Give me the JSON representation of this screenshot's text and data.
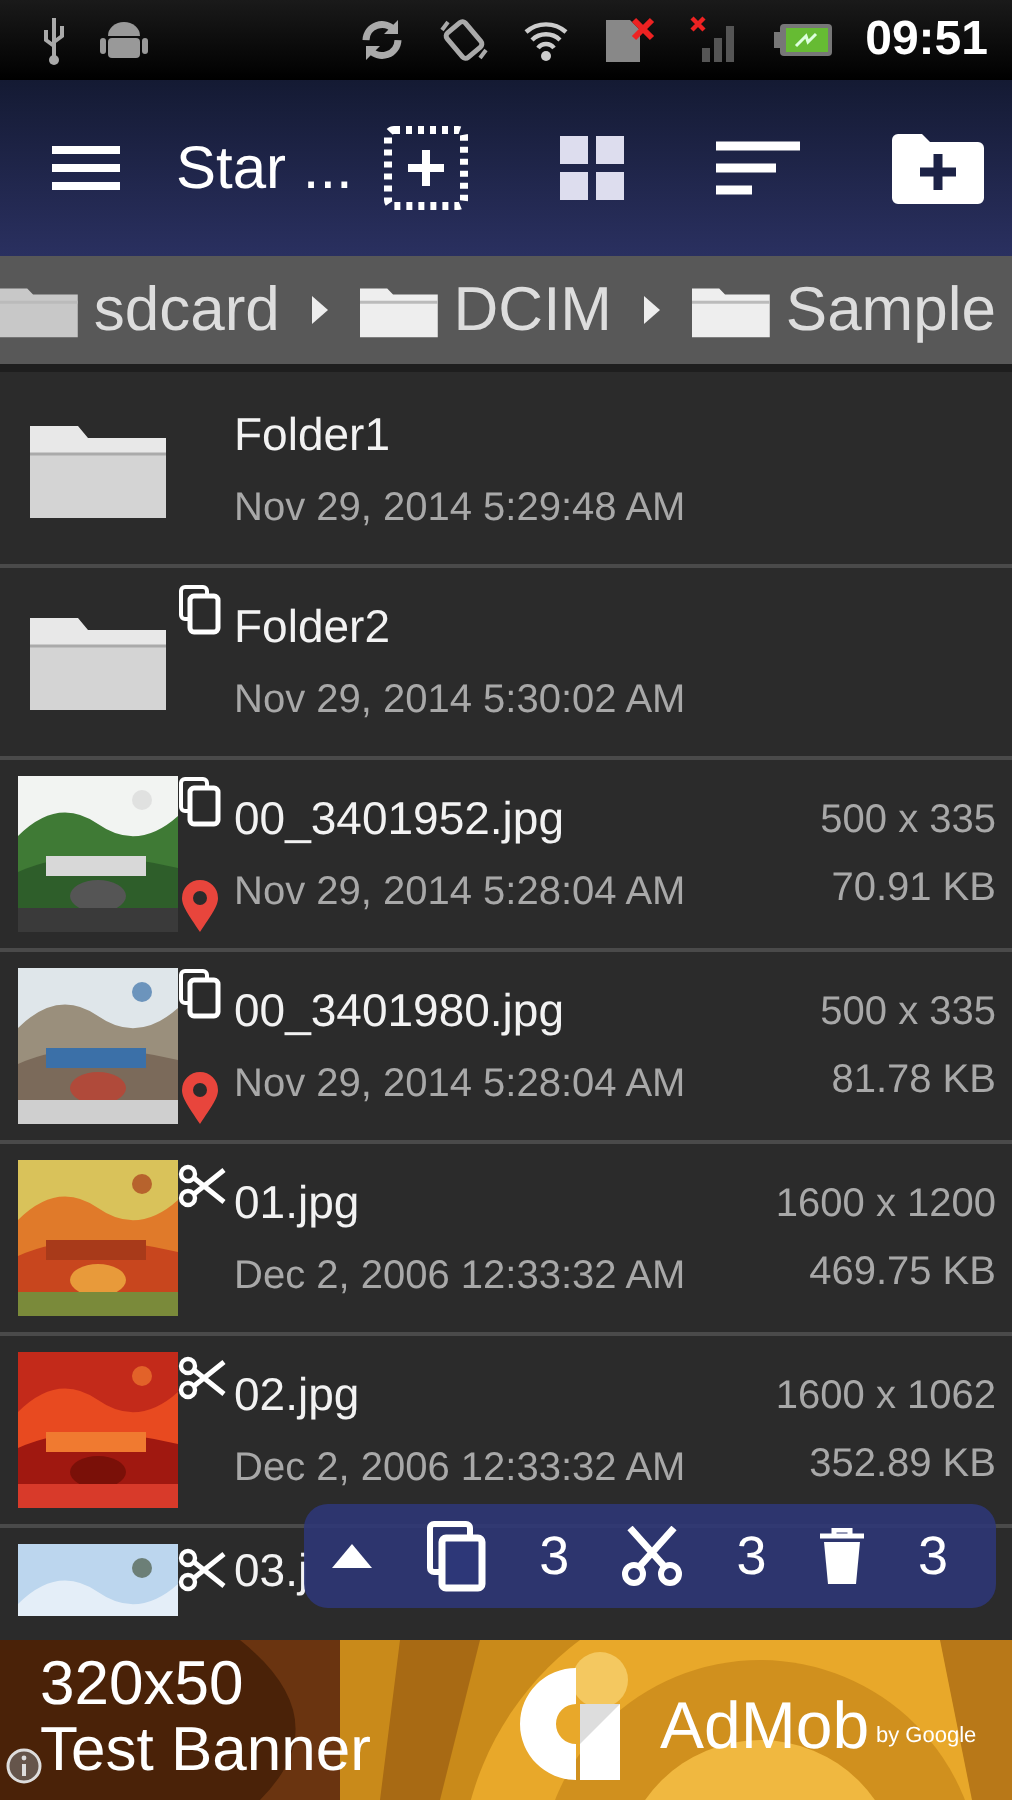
{
  "status_bar": {
    "time": "09:51"
  },
  "toolbar": {
    "title": "Star ..."
  },
  "breadcrumb": [
    {
      "label": "sdcard"
    },
    {
      "label": "DCIM"
    },
    {
      "label": "Sample"
    }
  ],
  "files": [
    {
      "kind": "folder",
      "name": "Folder1",
      "date": "Nov 29, 2014 5:29:48 AM",
      "copied": false,
      "cut": false,
      "geotagged": false
    },
    {
      "kind": "folder",
      "name": "Folder2",
      "date": "Nov 29, 2014 5:30:02 AM",
      "copied": true,
      "cut": false,
      "geotagged": false
    },
    {
      "name": "00_3401952.jpg",
      "date": "Nov 29, 2014 5:28:04 AM",
      "dimensions": "500 x 335",
      "size": "70.91 KB",
      "copied": true,
      "cut": false,
      "geotagged": true
    },
    {
      "name": "00_3401980.jpg",
      "date": "Nov 29, 2014 5:28:04 AM",
      "dimensions": "500 x 335",
      "size": "81.78 KB",
      "copied": true,
      "cut": false,
      "geotagged": true
    },
    {
      "name": "01.jpg",
      "date": "Dec 2, 2006 12:33:32 AM",
      "dimensions": "1600 x 1200",
      "size": "469.75 KB",
      "copied": false,
      "cut": true,
      "geotagged": false
    },
    {
      "name": "02.jpg",
      "date": "Dec 2, 2006 12:33:32 AM",
      "dimensions": "1600 x 1062",
      "size": "352.89 KB",
      "copied": false,
      "cut": true,
      "geotagged": false
    },
    {
      "name": "03.j",
      "copied": false,
      "cut": true,
      "geotagged": false
    }
  ],
  "selection_bar": {
    "counts": [
      {
        "kind": "copy",
        "count": "3"
      },
      {
        "kind": "cut",
        "count": "3"
      },
      {
        "kind": "delete",
        "count": "3"
      }
    ]
  },
  "ad": {
    "line_1": "320x50",
    "line_2": "Test Banner",
    "brand": "AdMob",
    "tagline": "by Google"
  }
}
